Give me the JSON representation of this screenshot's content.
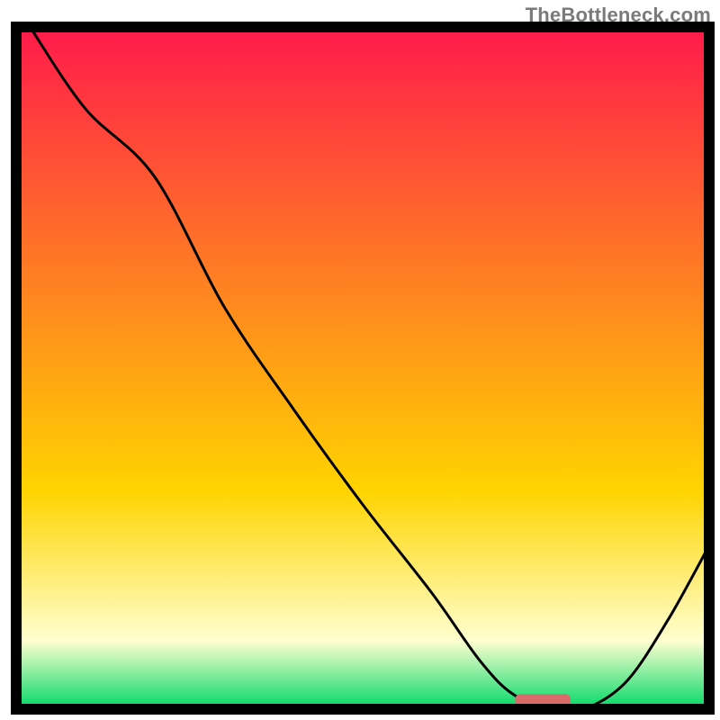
{
  "watermark": "TheBottleneck.com",
  "colors": {
    "top": "#ff1a4b",
    "mid": "#ffd400",
    "band_pale": "#ffffd0",
    "band_green": "#00d867",
    "line": "#000000",
    "marker": "#d96b6b",
    "frame": "#000000"
  },
  "chart_data": {
    "type": "line",
    "title": "",
    "xlabel": "",
    "ylabel": "",
    "xlim": [
      0,
      100
    ],
    "ylim": [
      0,
      100
    ],
    "x": [
      2,
      10,
      20,
      30,
      40,
      50,
      60,
      67,
      72,
      78,
      82,
      88,
      94,
      100
    ],
    "values": [
      100,
      88,
      78,
      59,
      44,
      30,
      17,
      7,
      2,
      0,
      0,
      4,
      13,
      24
    ],
    "marker": {
      "x_start": 72,
      "x_end": 80,
      "y": 1.3
    }
  }
}
